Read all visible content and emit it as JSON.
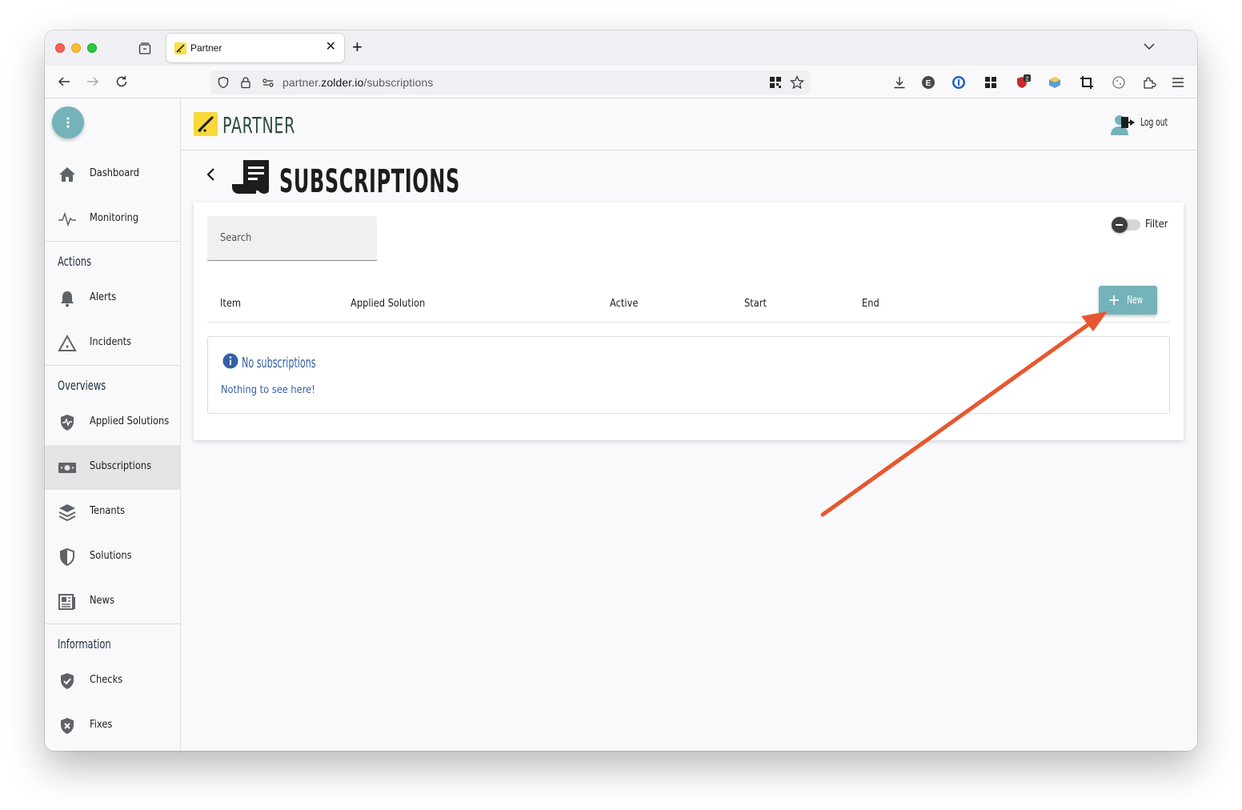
{
  "browser": {
    "tab_title": "Partner",
    "new_tab": "+",
    "url_prefix": "partner.",
    "url_domain": "zolder.io",
    "url_path": "/subscriptions",
    "extension_badge": "2"
  },
  "header": {
    "brand": "PARTNER",
    "logout_label": "Log out"
  },
  "sidebar": {
    "top_items": [
      {
        "label": "Dashboard",
        "icon": "home-icon"
      },
      {
        "label": "Monitoring",
        "icon": "pulse-icon"
      }
    ],
    "sections": [
      {
        "title": "Actions",
        "items": [
          {
            "label": "Alerts",
            "icon": "bell-icon"
          },
          {
            "label": "Incidents",
            "icon": "warning-icon"
          }
        ]
      },
      {
        "title": "Overviews",
        "items": [
          {
            "label": "Applied Solutions",
            "icon": "shield-pulse-icon"
          },
          {
            "label": "Subscriptions",
            "icon": "money-icon",
            "active": true
          },
          {
            "label": "Tenants",
            "icon": "layers-icon"
          },
          {
            "label": "Solutions",
            "icon": "shield-icon"
          },
          {
            "label": "News",
            "icon": "newspaper-icon"
          }
        ]
      },
      {
        "title": "Information",
        "items": [
          {
            "label": "Checks",
            "icon": "shield-check-icon"
          },
          {
            "label": "Fixes",
            "icon": "shield-wrench-icon"
          }
        ]
      }
    ]
  },
  "page": {
    "title": "SUBSCRIPTIONS",
    "search_placeholder": "Search",
    "filter_label": "Filter",
    "columns": [
      "Item",
      "Applied Solution",
      "Active",
      "Start",
      "End"
    ],
    "new_button": "New",
    "empty_title": "No subscriptions",
    "empty_text": "Nothing to see here!"
  },
  "colors": {
    "accent": "#74b3b9",
    "brand_yellow": "#f9d83a",
    "info_blue": "#3361a5",
    "annotation_arrow": "#e8572f"
  }
}
